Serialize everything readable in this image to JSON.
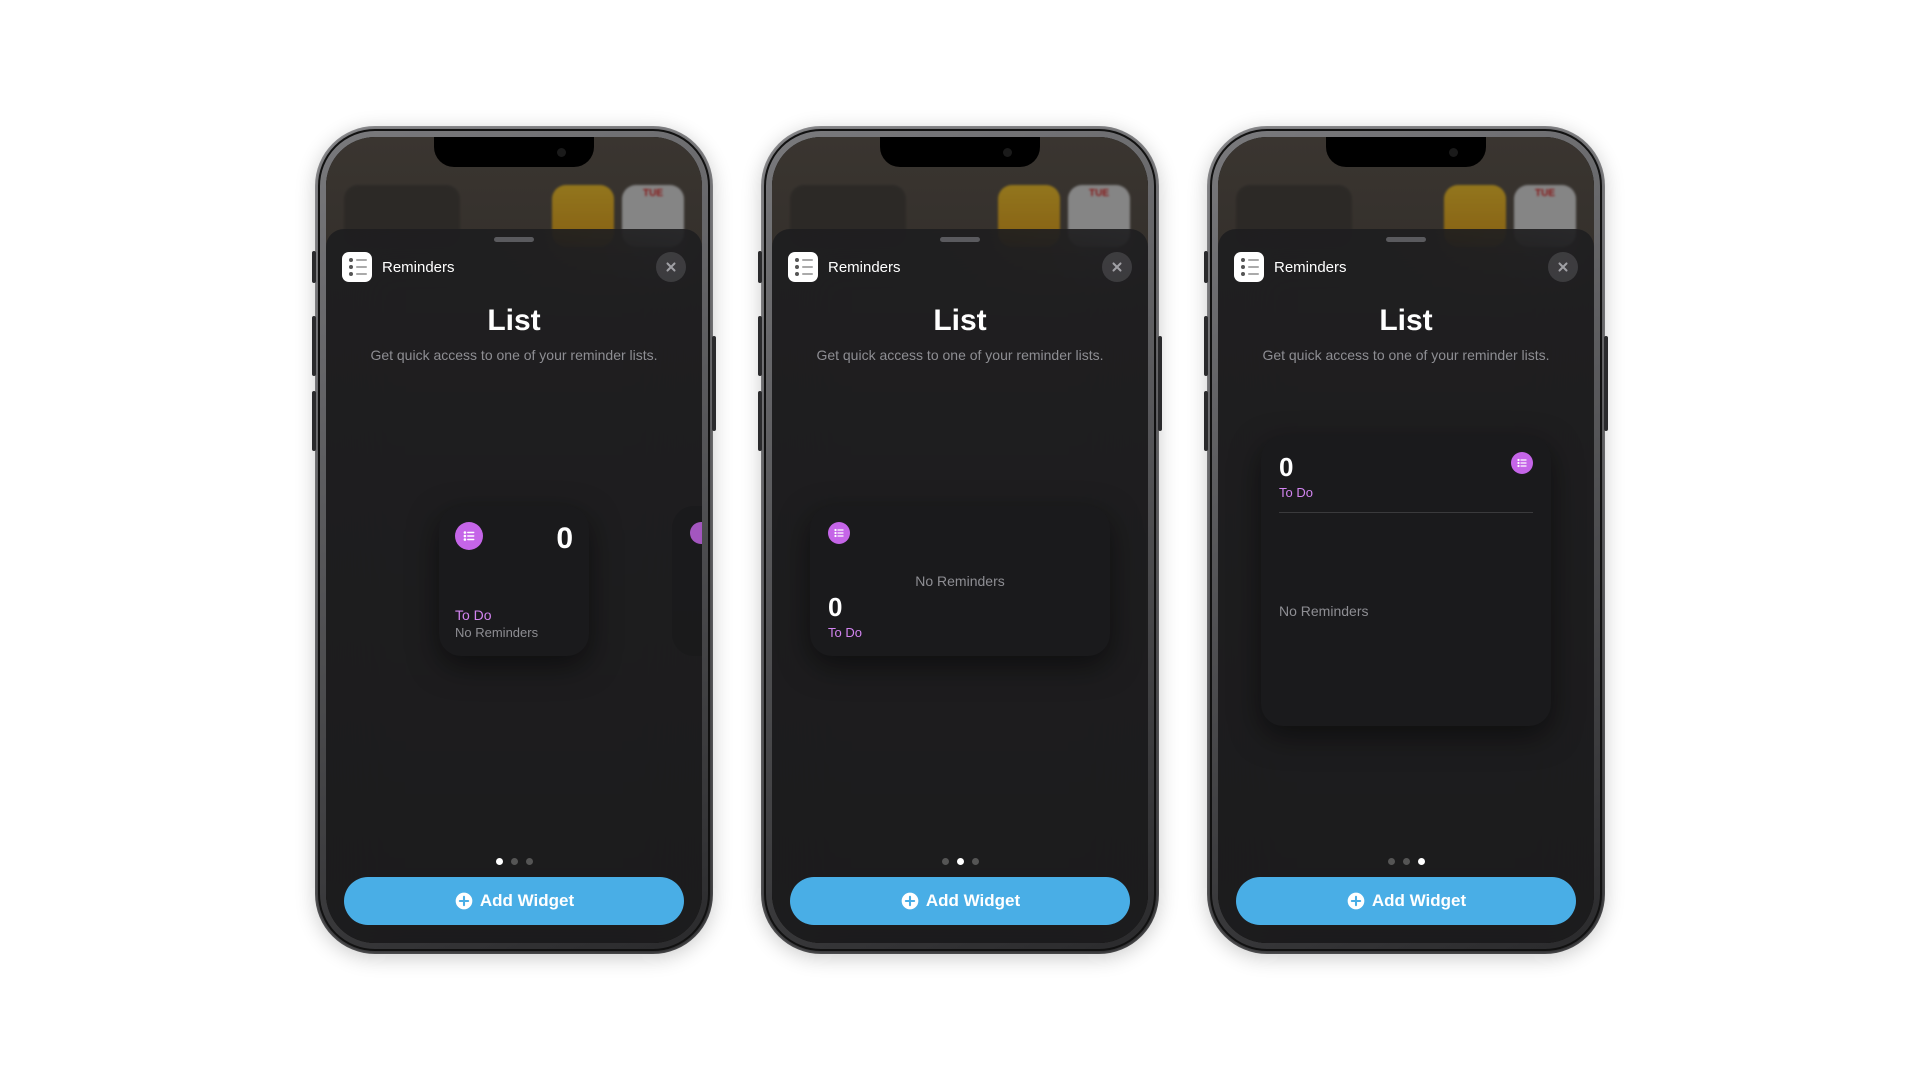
{
  "bg_day_label": "TUE",
  "sheet": {
    "app_name": "Reminders",
    "title": "List",
    "subtitle": "Get quick access to one of your reminder lists.",
    "add_button_label": "Add Widget"
  },
  "widget_preview": {
    "count": "0",
    "list_name": "To Do",
    "empty_message": "No Reminders"
  },
  "phones": [
    {
      "active_dot": 0,
      "size": "small"
    },
    {
      "active_dot": 1,
      "size": "medium"
    },
    {
      "active_dot": 2,
      "size": "large"
    }
  ]
}
